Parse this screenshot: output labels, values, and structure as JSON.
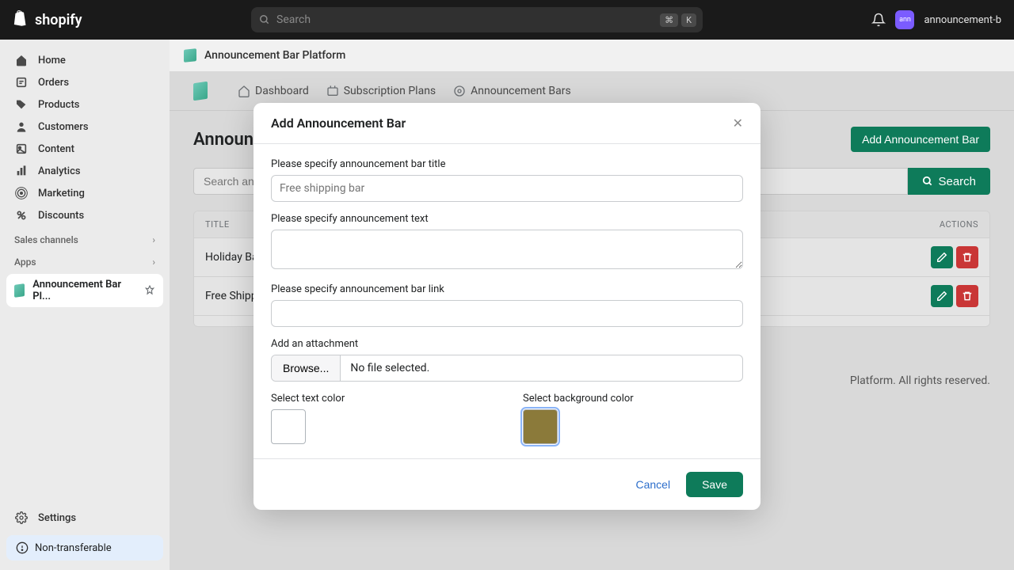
{
  "topbar": {
    "logo": "shopify",
    "search_placeholder": "Search",
    "kbd1": "⌘",
    "kbd2": "K",
    "store": "announcement-b"
  },
  "sidebar": {
    "items": [
      {
        "label": "Home"
      },
      {
        "label": "Orders"
      },
      {
        "label": "Products"
      },
      {
        "label": "Customers"
      },
      {
        "label": "Content"
      },
      {
        "label": "Analytics"
      },
      {
        "label": "Marketing"
      },
      {
        "label": "Discounts"
      }
    ],
    "sales_channels": "Sales channels",
    "apps": "Apps",
    "active_app": "Announcement Bar Pl...",
    "settings": "Settings",
    "badge": "Non-transferable"
  },
  "app_header": "Announcement Bar Platform",
  "subnav": {
    "items": [
      {
        "label": "Dashboard"
      },
      {
        "label": "Subscription Plans"
      },
      {
        "label": "Announcement Bars"
      }
    ]
  },
  "page": {
    "title": "Announcement Bars",
    "add_btn": "Add Announcement Bar",
    "search_placeholder": "Search announcement bar",
    "search_btn": "Search",
    "th_title": "TITLE",
    "th_actions": "ACTIONS",
    "rows": [
      {
        "title": "Holiday Bar"
      },
      {
        "title": "Free Shipping Bar"
      }
    ],
    "footer": "Platform. All rights reserved."
  },
  "modal": {
    "title": "Add Announcement Bar",
    "f1": "Please specify announcement bar title",
    "f1_ph": "Free shipping bar",
    "f2": "Please specify announcement text",
    "f3": "Please specify announcement bar link",
    "f4": "Add an attachment",
    "browse": "Browse...",
    "no_file": "No file selected.",
    "f5": "Select text color",
    "f6": "Select background color",
    "text_color": "#ffffff",
    "bg_color": "#8b7a3a",
    "cancel": "Cancel",
    "save": "Save"
  }
}
